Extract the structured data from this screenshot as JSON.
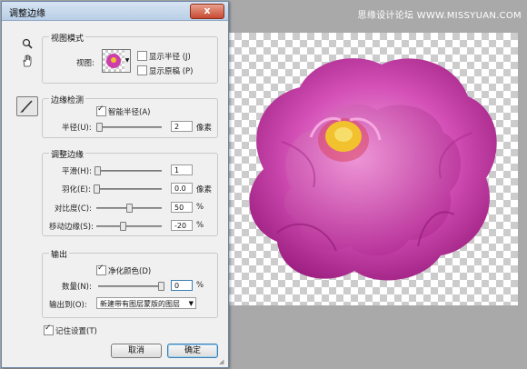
{
  "watermark": "思缘设计论坛 WWW.MISSYUAN.COM",
  "dialog": {
    "title": "调整边缘",
    "close": "x"
  },
  "tools": {
    "zoom": "zoom-icon",
    "hand": "hand-icon",
    "brush": "refine-radius-brush-icon"
  },
  "view_mode": {
    "legend": "视图模式",
    "view_label": "视图:",
    "show_radius": {
      "label": "显示半径 (J)",
      "checked": false
    },
    "show_original": {
      "label": "显示原稿 (P)",
      "checked": false
    }
  },
  "edge_detection": {
    "legend": "边缘检测",
    "smart_radius": {
      "label": "智能半径(A)",
      "checked": true
    },
    "radius": {
      "label": "半径(U):",
      "value": "2",
      "unit": "像素",
      "level": 0.02
    }
  },
  "adjust_edge": {
    "legend": "调整边缘",
    "smooth": {
      "label": "平滑(H):",
      "value": "1",
      "unit": "",
      "level": 0.01
    },
    "feather": {
      "label": "羽化(E):",
      "value": "0.0",
      "unit": "像素",
      "level": 0.0
    },
    "contrast": {
      "label": "对比度(C):",
      "value": "50",
      "unit": "%",
      "level": 0.5
    },
    "shift_edge": {
      "label": "移动边缘(S):",
      "value": "-20",
      "unit": "%",
      "level": 0.4
    }
  },
  "output": {
    "legend": "输出",
    "decontaminate": {
      "label": "净化颜色(D)",
      "checked": true
    },
    "amount": {
      "label": "数量(N):",
      "value": "0",
      "unit": "%",
      "level": 0.98
    },
    "output_to_label": "输出到(O):",
    "output_to_value": "新建带有图层蒙版的图层"
  },
  "remember": {
    "label": "记住设置(T)",
    "checked": true
  },
  "buttons": {
    "cancel": "取消",
    "ok": "确定"
  },
  "colors": {
    "flower_main": "#c63aa6",
    "flower_light": "#e58fd2",
    "center": "#f2c12e",
    "title_bar": "#c5d8ec"
  }
}
